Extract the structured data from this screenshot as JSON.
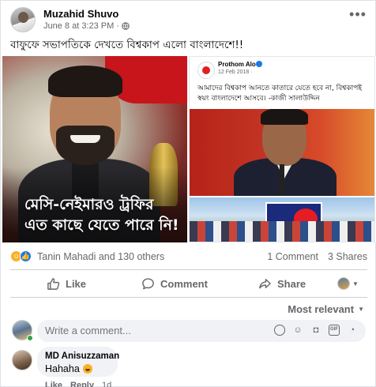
{
  "post": {
    "author": "Muzahid Shuvo",
    "timestamp": "June 8 at 3:23 PM",
    "separator": "·",
    "caption": "বাফুফে সভাপতিকে দেখতে বিশ্বকাপ এলো বাংলাদেশে!!",
    "more_icon": "more-horizontal-icon"
  },
  "media": {
    "left_overlay_line1": "মেসি-নেইমারও ট্রফির",
    "left_overlay_line2": "এত কাছে যেতে পারে নি!",
    "right_page_name": "Prothom Alo",
    "right_date": "12 Feb 2018 · ",
    "right_text": "আমাদের বিশ্বকাপ আনতে কাতারে যেতে হবে না, বিশ্বকাপই স্বয়ং বাংলাদেশে আসবে। -কাজী সালাউদ্দিন"
  },
  "reactions": {
    "summary": "Tanin Mahadi and 130 others",
    "comments": "1 Comment",
    "shares": "3 Shares",
    "icons": [
      "haha-icon",
      "like-icon"
    ]
  },
  "actions": {
    "like": "Like",
    "comment": "Comment",
    "share": "Share"
  },
  "comments_section": {
    "sort_label": "Most relevant",
    "composer_placeholder": "Write a comment...",
    "items": [
      {
        "author": "MD Anisuzzaman",
        "text": "Hahaha",
        "like": "Like",
        "reply": "Reply",
        "age": "1d"
      }
    ]
  },
  "colors": {
    "accent": "#1877f2",
    "muted_text": "#65676b",
    "bubble_bg": "#f0f2f5",
    "online": "#31a24c"
  }
}
